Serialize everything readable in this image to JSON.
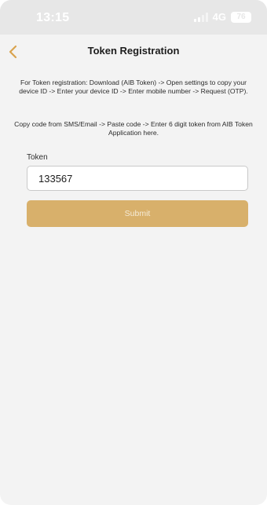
{
  "status_bar": {
    "time": "13:15",
    "network": "4G",
    "battery": "76",
    "icons": {
      "signal": "signal-bars-icon",
      "battery": "battery-icon"
    }
  },
  "nav": {
    "title": "Token Registration",
    "back_icon": "chevron-left-icon"
  },
  "instructions": {
    "line1": "For Token registration: Download (AIB Token) -> Open settings to copy your device ID -> Enter your device ID -> Enter mobile number -> Request (OTP).",
    "line2": "Copy code from SMS/Email -> Paste code -> Enter 6 digit token from AIB Token Application here."
  },
  "form": {
    "token_label": "Token",
    "token_value": "133567",
    "submit_label": "Submit"
  },
  "colors": {
    "accent": "#d8b06b",
    "back_arrow": "#d9a34f",
    "status_bar": "#e7e7e7",
    "background": "#f3f3f3"
  }
}
